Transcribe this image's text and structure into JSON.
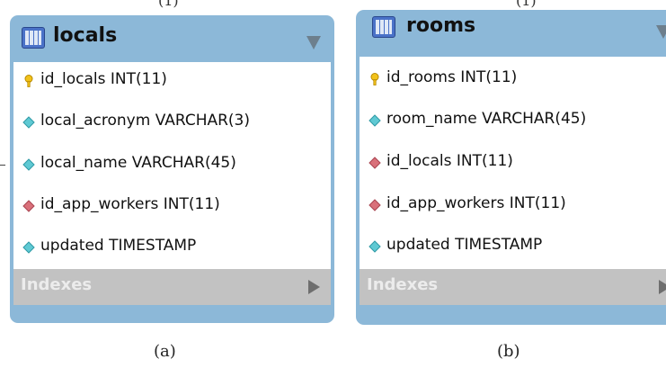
{
  "top_fragments": {
    "a": "(1)",
    "b": "(1)"
  },
  "tables": [
    {
      "title": "locals",
      "indexes_label": "Indexes",
      "columns": [
        {
          "text": "id_locals INT(11)",
          "icon": "primary-key-icon"
        },
        {
          "text": "local_acronym VARCHAR(3)",
          "icon": "column-icon"
        },
        {
          "text": "local_name VARCHAR(45)",
          "icon": "column-icon"
        },
        {
          "text": "id_app_workers INT(11)",
          "icon": "foreign-key-icon"
        },
        {
          "text": "updated TIMESTAMP",
          "icon": "column-icon"
        }
      ]
    },
    {
      "title": "rooms",
      "indexes_label": "Indexes",
      "columns": [
        {
          "text": "id_rooms INT(11)",
          "icon": "primary-key-icon"
        },
        {
          "text": "room_name VARCHAR(45)",
          "icon": "column-icon"
        },
        {
          "text": "id_locals INT(11)",
          "icon": "foreign-key-icon"
        },
        {
          "text": "id_app_workers INT(11)",
          "icon": "foreign-key-icon"
        },
        {
          "text": "updated TIMESTAMP",
          "icon": "column-icon"
        }
      ]
    }
  ],
  "captions": {
    "a": "(a)",
    "b": "(b)"
  },
  "colors": {
    "header": "#8cb8d8",
    "column_icon": "#5fc9d3",
    "foreign_key_icon": "#d9707a",
    "primary_key_icon": "#f2c21a",
    "indexes_bar": "#c2c2c2"
  }
}
